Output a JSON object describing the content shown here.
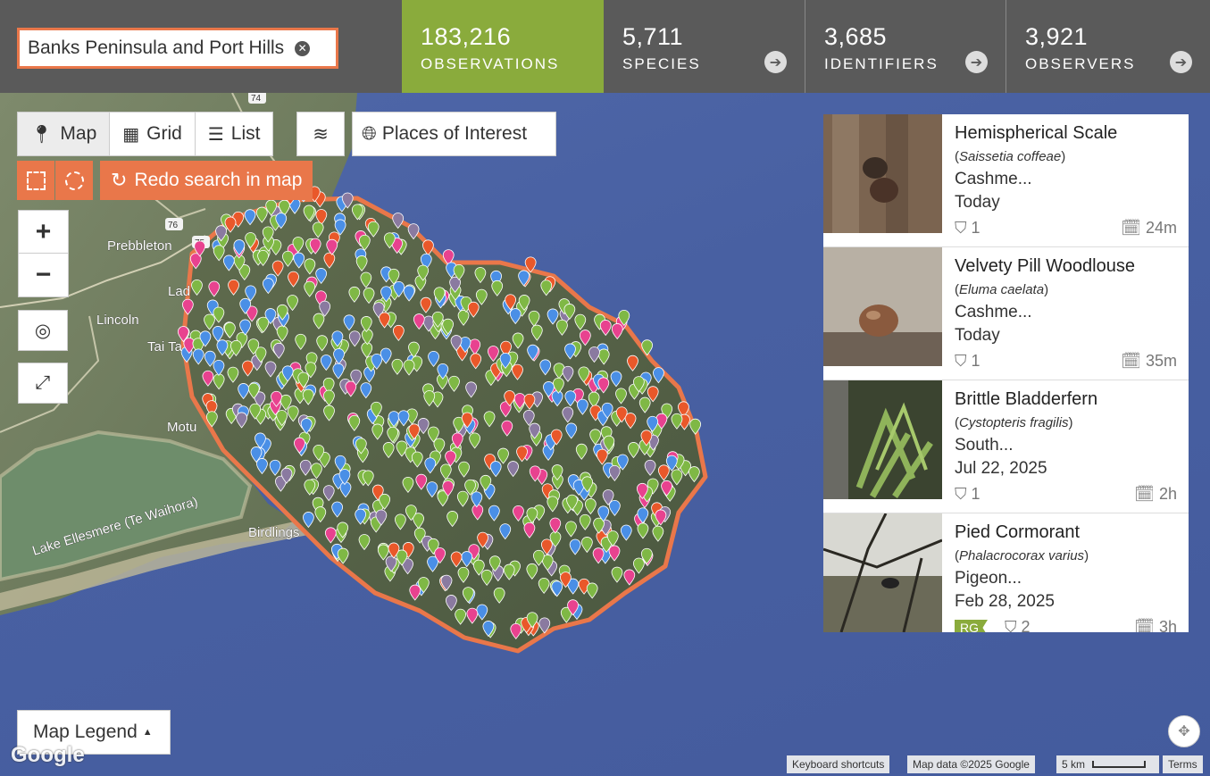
{
  "place": {
    "name": "Banks Peninsula and Port Hills"
  },
  "stats": {
    "observations": {
      "value": "183,216",
      "label": "OBSERVATIONS"
    },
    "species": {
      "value": "5,711",
      "label": "SPECIES"
    },
    "identifiers": {
      "value": "3,685",
      "label": "IDENTIFIERS"
    },
    "observers": {
      "value": "3,921",
      "label": "OBSERVERS"
    }
  },
  "view_tabs": [
    {
      "label": "Map",
      "icon": "map-marker-icon",
      "active": true
    },
    {
      "label": "Grid",
      "icon": "grid-icon",
      "active": false
    },
    {
      "label": "List",
      "icon": "list-icon",
      "active": false
    }
  ],
  "toolbar": {
    "layers_icon": "layers-icon",
    "places_label": "Places of Interest",
    "places_icon": "globe-icon",
    "redo_label": "Redo search in map",
    "zoom_in": "+",
    "zoom_out": "−"
  },
  "map_labels": {
    "prebbleton": "Prebbleton",
    "lincoln": "Lincoln",
    "lake": "Lake Ellesmere (Te Waihora)",
    "birdling": "Birdlings",
    "tai_tapu": "Tai Ta",
    "motukarara": "Motu",
    "ladbrooks": "Lad",
    "route_74": "74",
    "route_76": "76",
    "route_75": "75"
  },
  "legend": {
    "label": "Map Legend"
  },
  "attribution": {
    "google": "Google",
    "shortcuts": "Keyboard shortcuts",
    "mapdata": "Map data ©2025 Google",
    "scale": "5 km",
    "terms": "Terms"
  },
  "colors": {
    "accent": "#8aab3c",
    "orange": "#e9774a",
    "plants": "#7fb845",
    "insects": "#e8428f",
    "birds": "#4a8fe6",
    "fungi": "#e9582a",
    "other": "#8a7aa0"
  },
  "observations": [
    {
      "name": "Hemispherical Scale",
      "sci": "Saissetia coffeae",
      "place": "Cashme...",
      "date": "Today",
      "ids": "1",
      "age": "24m",
      "rg": ""
    },
    {
      "name": "Velvety Pill Woodlouse",
      "sci": "Eluma caelata",
      "place": "Cashme...",
      "date": "Today",
      "ids": "1",
      "age": "35m",
      "rg": ""
    },
    {
      "name": "Brittle Bladderfern",
      "sci": "Cystopteris fragilis",
      "place": "South...",
      "date": "Jul 22, 2025",
      "ids": "1",
      "age": "2h",
      "rg": ""
    },
    {
      "name": "Pied Cormorant",
      "sci": "Phalacrocorax varius",
      "place": "Pigeon...",
      "date": "Feb 28, 2025",
      "ids": "2",
      "age": "3h",
      "rg": "RG"
    }
  ]
}
